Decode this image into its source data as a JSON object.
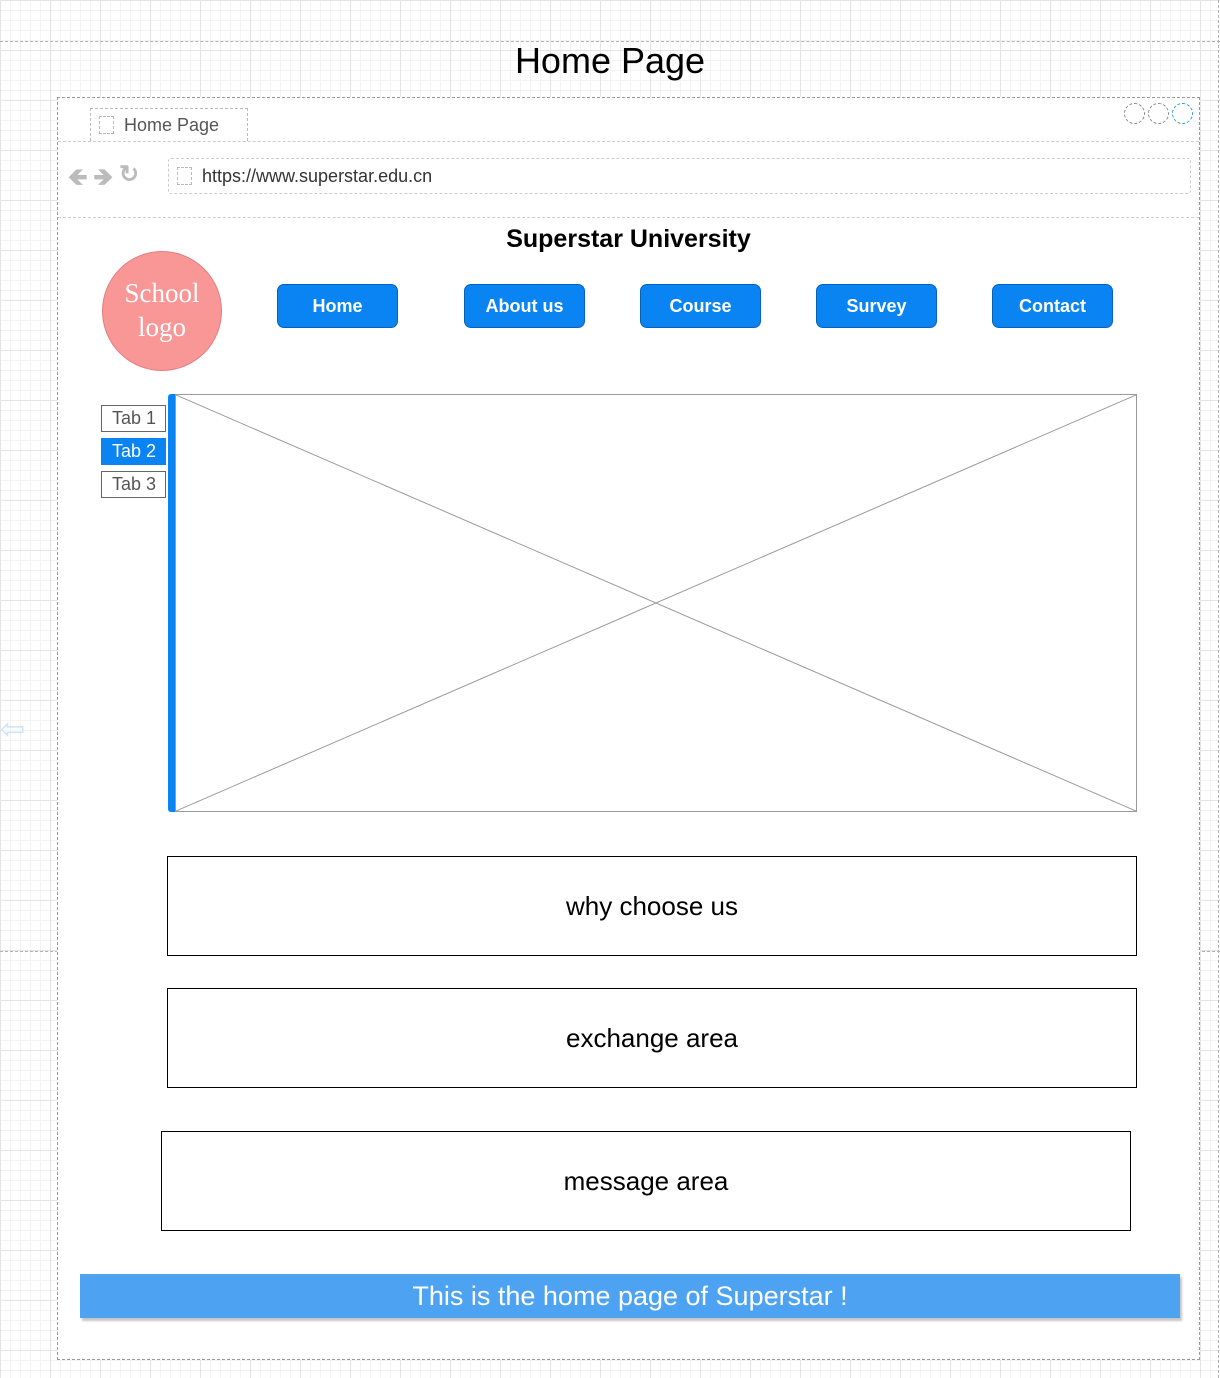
{
  "canvas": {
    "title": "Home Page"
  },
  "browser": {
    "tab_title": "Home Page",
    "url": "https://www.superstar.edu.cn",
    "icons": [
      "back-arrow-icon",
      "forward-arrow-icon",
      "refresh-icon",
      "page-icon"
    ],
    "window_controls": [
      "minimize",
      "maximize",
      "close"
    ]
  },
  "site": {
    "name": "Superstar University",
    "logo_text": "School logo",
    "nav": [
      "Home",
      "About us",
      "Course",
      "Survey",
      "Contact"
    ],
    "side_tabs": [
      "Tab 1",
      "Tab 2",
      "Tab 3"
    ],
    "active_side_tab": "Tab 2",
    "sections": [
      "why choose us",
      "exchange area",
      "message area"
    ],
    "footer": "This is the home page of Superstar !"
  },
  "colors": {
    "primary_blue": "#0a84f2",
    "footer_blue": "#4da3f2",
    "logo_pink": "#f99696"
  }
}
